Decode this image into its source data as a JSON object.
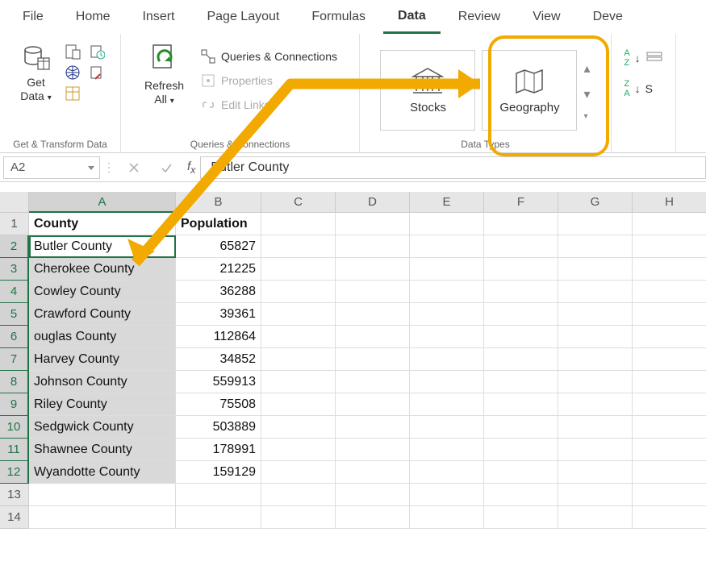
{
  "tabs": [
    "File",
    "Home",
    "Insert",
    "Page Layout",
    "Formulas",
    "Data",
    "Review",
    "View",
    "Deve"
  ],
  "active_tab": "Data",
  "ribbon": {
    "get_data": {
      "label": "Get\nData",
      "group_label": "Get & Transform Data"
    },
    "refresh": {
      "label": "Refresh\nAll"
    },
    "queries": {
      "q_and_c": "Queries & Connections",
      "properties": "Properties",
      "edit_links": "Edit Links",
      "group_label": "Queries & Connections"
    },
    "datatypes": {
      "stocks": "Stocks",
      "geography": "Geography",
      "group_label": "Data Types"
    },
    "sort": {
      "s": "S"
    }
  },
  "name_box": "A2",
  "formula_value": "Butler County",
  "columns": [
    "A",
    "B",
    "C",
    "D",
    "E",
    "F",
    "G",
    "H"
  ],
  "headers": {
    "col1": "County",
    "col2": "Population"
  },
  "rows": [
    {
      "n": 1,
      "a": "County",
      "b": "Population",
      "hdr": true
    },
    {
      "n": 2,
      "a": "Butler County",
      "b": "65827"
    },
    {
      "n": 3,
      "a": "Cherokee County",
      "b": "21225"
    },
    {
      "n": 4,
      "a": "Cowley County",
      "b": "36288"
    },
    {
      "n": 5,
      "a": "Crawford County",
      "b": "39361"
    },
    {
      "n": 6,
      "a": "ouglas County",
      "b": "112864"
    },
    {
      "n": 7,
      "a": "Harvey County",
      "b": "34852"
    },
    {
      "n": 8,
      "a": "Johnson County",
      "b": "559913"
    },
    {
      "n": 9,
      "a": "Riley County",
      "b": "75508"
    },
    {
      "n": 10,
      "a": "Sedgwick County",
      "b": "503889"
    },
    {
      "n": 11,
      "a": "Shawnee County",
      "b": "178991"
    },
    {
      "n": 12,
      "a": "Wyandotte County",
      "b": "159129"
    },
    {
      "n": 13,
      "a": "",
      "b": ""
    },
    {
      "n": 14,
      "a": "",
      "b": ""
    }
  ],
  "annotation": {
    "color": "#f2a900"
  }
}
